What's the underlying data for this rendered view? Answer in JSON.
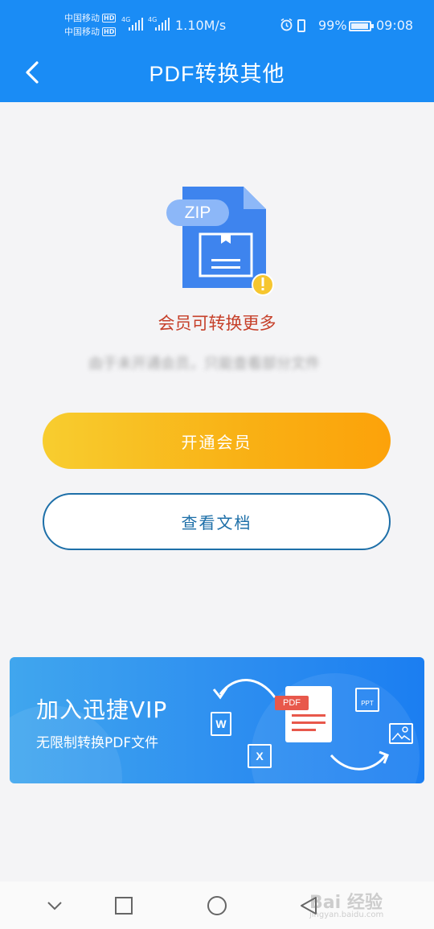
{
  "status_bar": {
    "carrier_1": "中国移动",
    "carrier_2": "中国移动",
    "hd_label": "HD",
    "network_1": "4G",
    "network_2": "4G",
    "speed": "1.10M/s",
    "battery_percent": "99%",
    "time": "09:08"
  },
  "header": {
    "title": "PDF转换其他",
    "back_icon": "chevron-left-icon"
  },
  "content": {
    "file_badge": "ZIP",
    "notice": "会员可转换更多",
    "blurred_text": "由于未开通会员，只能查看部分文件",
    "primary_button": "开通会员",
    "secondary_button": "查看文档"
  },
  "banner": {
    "title": "加入迅捷VIP",
    "subtitle": "无限制转换PDF文件",
    "pdf_label": "PDF",
    "ppt_label": "PPT",
    "word_label": "W",
    "excel_label": "X"
  },
  "nav": {
    "back_icon": "chevron-down-icon",
    "home_icon": "square-icon",
    "circle_icon": "circle-icon",
    "triangle_icon": "triangle-back-icon"
  },
  "watermark": {
    "text": "Bai 经验",
    "url": "jingyan.baidu.com"
  },
  "colors": {
    "header_bg": "#1a8cf5",
    "notice": "#c6402a",
    "primary_gradient_start": "#f8cd2f",
    "primary_gradient_end": "#fca20a",
    "secondary_border": "#1d6fa8",
    "banner_bg": "#2d8ef0"
  }
}
